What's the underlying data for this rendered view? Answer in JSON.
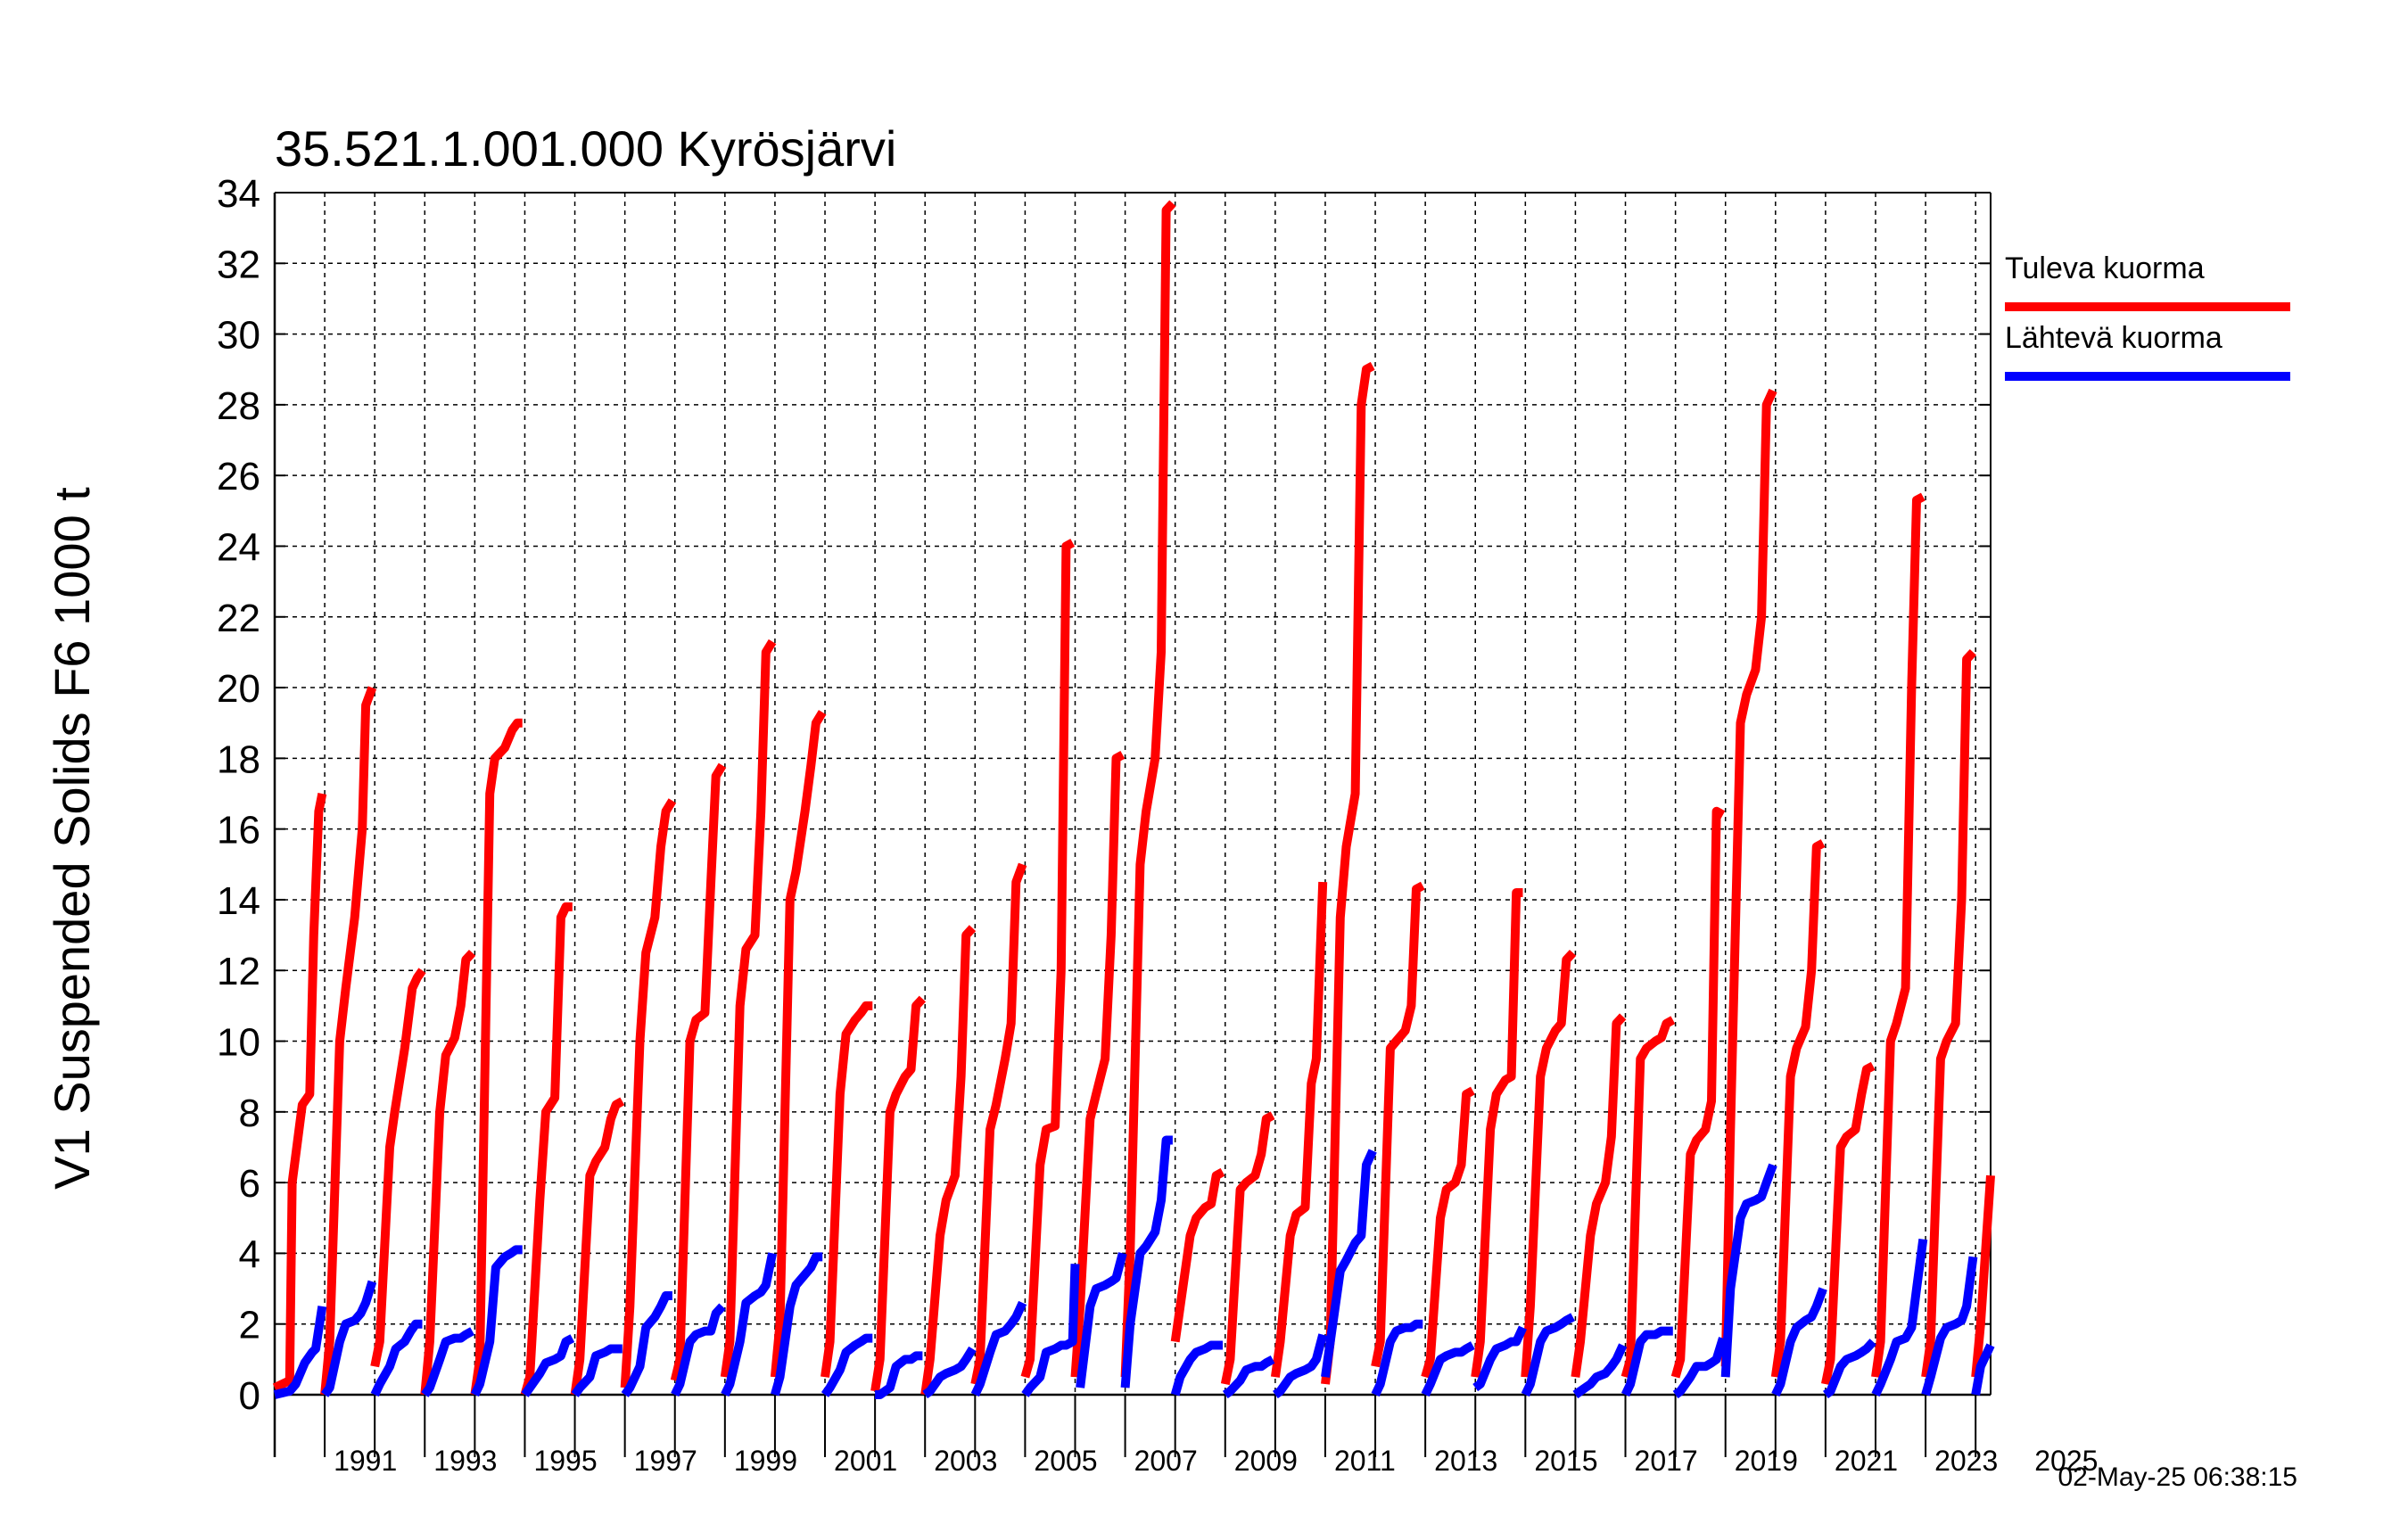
{
  "stamp": "02-May-25 06:38:15",
  "chart_data": {
    "type": "line",
    "title": "35.521.1.001.000 Kyrösjärvi",
    "xlabel": "",
    "ylabel": "V1 Suspended Solids F6 1000 t",
    "xlim": [
      1990.0,
      2024.3
    ],
    "ylim": [
      0,
      34
    ],
    "yticks": [
      0,
      2,
      4,
      6,
      8,
      10,
      12,
      14,
      16,
      18,
      20,
      22,
      24,
      26,
      28,
      30,
      32,
      34
    ],
    "xtick_labels": [
      "1991",
      "1993",
      "1995",
      "1997",
      "1999",
      "2001",
      "2003",
      "2005",
      "2007",
      "2009",
      "2011",
      "2013",
      "2015",
      "2017",
      "2019",
      "2021",
      "2023",
      "2025"
    ],
    "grid": true,
    "legend_position": "right",
    "series": [
      {
        "name": "Tuleva kuorma",
        "color": "#ff0000",
        "x": [
          1990,
          1990.3,
          1990.35,
          1990.55,
          1990.7,
          1990.78,
          1990.88,
          1990.95,
          1991,
          1991.1,
          1991.3,
          1991.42,
          1991.6,
          1991.75,
          1991.82,
          1991.95,
          1992,
          1992.1,
          1992.3,
          1992.4,
          1992.6,
          1992.75,
          1992.85,
          1992.95,
          1993,
          1993.1,
          1993.3,
          1993.42,
          1993.6,
          1993.72,
          1993.82,
          1993.95,
          1994,
          1994.1,
          1994.3,
          1994.4,
          1994.6,
          1994.75,
          1994.85,
          1994.95,
          1995,
          1995.1,
          1995.3,
          1995.42,
          1995.6,
          1995.72,
          1995.82,
          1995.95,
          1996,
          1996.1,
          1996.3,
          1996.42,
          1996.6,
          1996.72,
          1996.82,
          1996.95,
          1997,
          1997.1,
          1997.3,
          1997.42,
          1997.6,
          1997.72,
          1997.82,
          1997.95,
          1998,
          1998.1,
          1998.3,
          1998.42,
          1998.6,
          1998.72,
          1998.82,
          1998.95,
          1999,
          1999.1,
          1999.3,
          1999.42,
          1999.6,
          1999.72,
          1999.82,
          1999.95,
          2000,
          2000.1,
          2000.3,
          2000.42,
          2000.6,
          2000.72,
          2000.82,
          2000.95,
          2001,
          2001.1,
          2001.3,
          2001.42,
          2001.6,
          2001.72,
          2001.82,
          2001.95,
          2002,
          2002.1,
          2002.3,
          2002.42,
          2002.6,
          2002.72,
          2002.82,
          2002.95,
          2003,
          2003.1,
          2003.3,
          2003.42,
          2003.6,
          2003.72,
          2003.82,
          2003.95,
          2004,
          2004.1,
          2004.3,
          2004.42,
          2004.6,
          2004.72,
          2004.82,
          2004.95,
          2005,
          2005.1,
          2005.3,
          2005.42,
          2005.6,
          2005.72,
          2005.82,
          2005.95,
          2006,
          2006.1,
          2006.3,
          2006.42,
          2006.6,
          2006.72,
          2006.82,
          2006.95,
          2007,
          2007.1,
          2007.3,
          2007.42,
          2007.6,
          2007.72,
          2007.82,
          2007.95,
          2008,
          2008.1,
          2008.3,
          2008.42,
          2008.6,
          2008.72,
          2008.82,
          2008.95,
          2009,
          2009.1,
          2009.3,
          2009.42,
          2009.6,
          2009.72,
          2009.82,
          2009.95,
          2010,
          2010.1,
          2010.3,
          2010.42,
          2010.6,
          2010.72,
          2010.82,
          2010.95,
          2011,
          2011.1,
          2011.3,
          2011.42,
          2011.6,
          2011.72,
          2011.82,
          2011.95,
          2012,
          2012.1,
          2012.3,
          2012.42,
          2012.6,
          2012.72,
          2012.82,
          2012.95,
          2013,
          2013.1,
          2013.3,
          2013.42,
          2013.6,
          2013.72,
          2013.82,
          2013.95,
          2014,
          2014.1,
          2014.3,
          2014.42,
          2014.6,
          2014.72,
          2014.82,
          2014.95,
          2015,
          2015.1,
          2015.3,
          2015.42,
          2015.6,
          2015.72,
          2015.82,
          2015.95,
          2016,
          2016.1,
          2016.3,
          2016.42,
          2016.6,
          2016.72,
          2016.82,
          2016.95,
          2017,
          2017.1,
          2017.3,
          2017.42,
          2017.6,
          2017.72,
          2017.82,
          2017.95,
          2018,
          2018.1,
          2018.3,
          2018.42,
          2018.6,
          2018.72,
          2018.82,
          2018.95,
          2019,
          2019.1,
          2019.3,
          2019.42,
          2019.6,
          2019.72,
          2019.82,
          2019.95,
          2020,
          2020.1,
          2020.3,
          2020.42,
          2020.6,
          2020.72,
          2020.82,
          2020.95,
          2021,
          2021.1,
          2021.3,
          2021.42,
          2021.6,
          2021.72,
          2021.82,
          2021.95,
          2022,
          2022.1,
          2022.3,
          2022.42,
          2022.6,
          2022.72,
          2022.82,
          2022.95,
          2023,
          2023.1,
          2023.3,
          2023.42,
          2023.6,
          2023.72,
          2023.82,
          2023.95,
          2024,
          2024.1,
          2024.3
        ],
        "y": [
          0.2,
          0.4,
          6,
          8.2,
          8.5,
          13,
          16.5,
          17,
          0,
          1.5,
          10,
          11.5,
          13.5,
          16,
          19.5,
          20,
          0.8,
          1.5,
          7,
          8,
          9.8,
          11.5,
          11.8,
          12,
          0,
          1.5,
          8,
          9.6,
          10.1,
          11,
          12.3,
          12.5,
          0,
          1,
          17,
          18,
          18.3,
          18.8,
          19,
          19,
          0,
          0.5,
          5.5,
          8,
          8.4,
          13.5,
          13.8,
          13.8,
          0,
          1,
          6.2,
          6.6,
          7,
          7.8,
          8.2,
          8.3,
          0.2,
          2.5,
          10,
          12.5,
          13.5,
          15.5,
          16.5,
          16.8,
          0.4,
          1,
          10,
          10.6,
          10.8,
          14.5,
          17.5,
          17.8,
          0.5,
          1.5,
          11,
          12.6,
          13,
          16.5,
          21,
          21.3,
          0.5,
          2,
          14,
          14.8,
          16.5,
          17.8,
          19,
          19.3,
          0.5,
          1.5,
          8.5,
          10.2,
          10.6,
          10.8,
          11,
          11,
          0.1,
          1,
          8,
          8.5,
          9,
          9.2,
          11,
          11.2,
          0,
          1,
          4.5,
          5.5,
          6.2,
          9,
          13,
          13.2,
          0.3,
          1,
          7.5,
          8.2,
          9.5,
          10.5,
          14.5,
          15,
          0.5,
          1,
          6.5,
          7.5,
          7.6,
          12,
          24,
          24.1,
          0.5,
          2.5,
          7.8,
          8.5,
          9.5,
          13,
          18,
          18.1,
          0.5,
          4,
          15,
          16.5,
          18,
          21,
          33.5,
          33.7,
          1.5,
          2.5,
          4.5,
          5,
          5.3,
          5.4,
          6.2,
          6.3,
          0.3,
          1,
          5.8,
          6,
          6.2,
          6.8,
          7.8,
          7.9,
          0.5,
          1.5,
          4.5,
          5.1,
          5.3,
          8.8,
          9.5,
          14.5,
          0.3,
          1.5,
          13.5,
          15.5,
          17,
          28,
          29,
          29.1,
          0.8,
          1.5,
          9.8,
          10,
          10.3,
          11,
          14.3,
          14.4,
          0.5,
          1,
          5,
          5.8,
          6,
          6.5,
          8.5,
          8.6,
          0.5,
          1.5,
          7.5,
          8.5,
          8.9,
          9,
          14.2,
          14.2,
          0.5,
          2.5,
          9,
          9.8,
          10.3,
          10.5,
          12.3,
          12.5,
          0.5,
          1.5,
          4.5,
          5.4,
          6,
          7.3,
          10.5,
          10.7,
          0.5,
          1,
          9.5,
          9.8,
          10,
          10.1,
          10.5,
          10.6,
          0.5,
          1,
          6.8,
          7.2,
          7.5,
          8.3,
          16.5,
          16.4,
          0.8,
          7.5,
          19,
          19.8,
          20.5,
          22,
          28,
          28.4,
          0.5,
          1.5,
          9,
          9.8,
          10.4,
          12,
          15.5,
          15.6,
          0.3,
          1,
          7,
          7.3,
          7.5,
          8.5,
          9.2,
          9.3,
          0.5,
          1.5,
          10,
          10.5,
          11.5,
          20,
          25.3,
          25.4,
          0.5,
          1.5,
          9.5,
          10,
          10.5,
          14,
          20.8,
          21,
          0.5,
          2,
          6.2
        ]
      },
      {
        "name": "Lähtevä kuorma",
        "color": "#0000ff",
        "x": [
          1990,
          1990.3,
          1990.42,
          1990.6,
          1990.75,
          1990.82,
          1990.95,
          1991,
          1991.1,
          1991.3,
          1991.42,
          1991.6,
          1991.72,
          1991.82,
          1991.95,
          1992,
          1992.1,
          1992.3,
          1992.42,
          1992.6,
          1992.72,
          1992.82,
          1992.95,
          1993,
          1993.1,
          1993.3,
          1993.42,
          1993.6,
          1993.72,
          1993.82,
          1993.95,
          1994,
          1994.1,
          1994.3,
          1994.42,
          1994.6,
          1994.72,
          1994.82,
          1994.95,
          1995,
          1995.1,
          1995.3,
          1995.42,
          1995.6,
          1995.72,
          1995.82,
          1995.95,
          1996,
          1996.1,
          1996.3,
          1996.42,
          1996.6,
          1996.72,
          1996.82,
          1996.95,
          1997,
          1997.1,
          1997.3,
          1997.42,
          1997.6,
          1997.72,
          1997.82,
          1997.95,
          1998,
          1998.1,
          1998.3,
          1998.42,
          1998.6,
          1998.72,
          1998.82,
          1998.95,
          1999,
          1999.1,
          1999.3,
          1999.42,
          1999.6,
          1999.72,
          1999.82,
          1999.95,
          2000,
          2000.1,
          2000.3,
          2000.42,
          2000.6,
          2000.72,
          2000.82,
          2000.95,
          2001,
          2001.1,
          2001.3,
          2001.42,
          2001.6,
          2001.72,
          2001.82,
          2001.95,
          2002,
          2002.1,
          2002.3,
          2002.42,
          2002.6,
          2002.72,
          2002.82,
          2002.95,
          2003,
          2003.1,
          2003.3,
          2003.42,
          2003.6,
          2003.72,
          2003.82,
          2003.95,
          2004,
          2004.1,
          2004.3,
          2004.42,
          2004.6,
          2004.72,
          2004.82,
          2004.95,
          2005,
          2005.1,
          2005.3,
          2005.42,
          2005.6,
          2005.72,
          2005.82,
          2005.95,
          2006,
          2006.1,
          2006.3,
          2006.42,
          2006.6,
          2006.72,
          2006.82,
          2006.95,
          2007,
          2007.1,
          2007.3,
          2007.42,
          2007.6,
          2007.72,
          2007.82,
          2007.95,
          2008,
          2008.1,
          2008.3,
          2008.42,
          2008.6,
          2008.72,
          2008.82,
          2008.95,
          2009,
          2009.1,
          2009.3,
          2009.42,
          2009.6,
          2009.72,
          2009.82,
          2009.95,
          2010,
          2010.1,
          2010.3,
          2010.42,
          2010.6,
          2010.72,
          2010.82,
          2010.95,
          2011,
          2011.1,
          2011.3,
          2011.42,
          2011.6,
          2011.72,
          2011.82,
          2011.95,
          2012,
          2012.1,
          2012.3,
          2012.42,
          2012.6,
          2012.72,
          2012.82,
          2012.95,
          2013,
          2013.1,
          2013.3,
          2013.42,
          2013.6,
          2013.72,
          2013.82,
          2013.95,
          2014,
          2014.1,
          2014.3,
          2014.42,
          2014.6,
          2014.72,
          2014.82,
          2014.95,
          2015,
          2015.1,
          2015.3,
          2015.42,
          2015.6,
          2015.72,
          2015.82,
          2015.95,
          2016,
          2016.1,
          2016.3,
          2016.42,
          2016.6,
          2016.72,
          2016.82,
          2016.95,
          2017,
          2017.1,
          2017.3,
          2017.42,
          2017.6,
          2017.72,
          2017.82,
          2017.95,
          2018,
          2018.1,
          2018.3,
          2018.42,
          2018.6,
          2018.72,
          2018.82,
          2018.95,
          2019,
          2019.1,
          2019.3,
          2019.42,
          2019.6,
          2019.72,
          2019.82,
          2019.95,
          2020,
          2020.1,
          2020.3,
          2020.42,
          2020.6,
          2020.72,
          2020.82,
          2020.95,
          2021,
          2021.1,
          2021.3,
          2021.42,
          2021.6,
          2021.72,
          2021.82,
          2021.95,
          2022,
          2022.1,
          2022.3,
          2022.42,
          2022.6,
          2022.72,
          2022.82,
          2022.95,
          2023,
          2023.1,
          2023.3,
          2023.42,
          2023.6,
          2023.72,
          2023.82,
          2023.95,
          2024,
          2024.1,
          2024.3
        ],
        "y": [
          0,
          0.1,
          0.3,
          0.9,
          1.2,
          1.3,
          2.5,
          0,
          0.2,
          1.5,
          2,
          2.1,
          2.3,
          2.6,
          3.2,
          0,
          0.3,
          0.8,
          1.3,
          1.5,
          1.8,
          2,
          2,
          0,
          0.2,
          1,
          1.5,
          1.6,
          1.6,
          1.7,
          1.8,
          0,
          0.3,
          1.5,
          3.6,
          3.9,
          4,
          4.1,
          4.1,
          0,
          0.2,
          0.6,
          0.9,
          1,
          1.1,
          1.5,
          1.6,
          0,
          0.2,
          0.5,
          1.1,
          1.2,
          1.3,
          1.3,
          1.3,
          0,
          0.2,
          0.8,
          1.9,
          2.2,
          2.5,
          2.8,
          2.8,
          0,
          0.3,
          1.5,
          1.7,
          1.8,
          1.8,
          2.3,
          2.5,
          0,
          0.3,
          1.5,
          2.6,
          2.8,
          2.9,
          3.1,
          4,
          0,
          0.5,
          2.5,
          3.1,
          3.4,
          3.6,
          3.9,
          3.9,
          0,
          0.2,
          0.7,
          1.2,
          1.4,
          1.5,
          1.6,
          1.6,
          0,
          0,
          0.2,
          0.8,
          1,
          1,
          1.1,
          1.1,
          0,
          0.1,
          0.5,
          0.6,
          0.7,
          0.8,
          1,
          1.3,
          0,
          0.3,
          1.2,
          1.7,
          1.8,
          2,
          2.2,
          2.6,
          0,
          0.2,
          0.5,
          1.2,
          1.3,
          1.4,
          1.4,
          1.5,
          3.7,
          0.2,
          2.5,
          3,
          3.1,
          3.2,
          3.3,
          4,
          0.2,
          2,
          4,
          4.2,
          4.6,
          5.5,
          7.2,
          7.2,
          0,
          0.5,
          1,
          1.2,
          1.3,
          1.4,
          1.4,
          1.4,
          0,
          0.1,
          0.4,
          0.7,
          0.8,
          0.8,
          0.9,
          1,
          0,
          0.1,
          0.5,
          0.6,
          0.7,
          0.8,
          1,
          1.7,
          0.5,
          1.5,
          3.5,
          3.8,
          4.3,
          4.5,
          6.5,
          6.9,
          0,
          0.3,
          1.5,
          1.8,
          1.9,
          1.9,
          2,
          2,
          0,
          0.3,
          1,
          1.1,
          1.2,
          1.2,
          1.3,
          1.4,
          0.2,
          0.3,
          1,
          1.3,
          1.4,
          1.5,
          1.5,
          1.9,
          0,
          0.3,
          1.5,
          1.8,
          1.9,
          2,
          2.1,
          2.2,
          0,
          0.1,
          0.3,
          0.5,
          0.6,
          0.8,
          1,
          1.4,
          0,
          0.3,
          1.5,
          1.7,
          1.7,
          1.8,
          1.8,
          1.8,
          0,
          0.1,
          0.5,
          0.8,
          0.8,
          0.9,
          1,
          1.6,
          0.5,
          3,
          5,
          5.4,
          5.5,
          5.6,
          6,
          6.5,
          0,
          0.3,
          1.5,
          1.9,
          2.1,
          2.2,
          2.5,
          3,
          0,
          0.1,
          0.8,
          1,
          1.1,
          1.2,
          1.3,
          1.5,
          0,
          0.3,
          1,
          1.5,
          1.6,
          1.9,
          3,
          4.4,
          0,
          0.5,
          1.6,
          1.9,
          2,
          2.1,
          2.5,
          3.9,
          0,
          0.8,
          1.4
        ]
      }
    ]
  }
}
